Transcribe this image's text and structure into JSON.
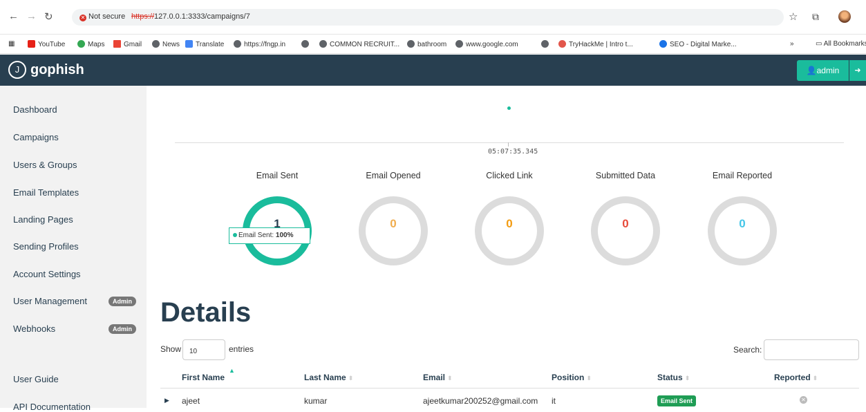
{
  "browser": {
    "not_secure": "Not secure",
    "url_scheme": "https://",
    "url_rest": "127.0.0.1:3333/campaigns/7",
    "bookmarks": [
      "YouTube",
      "Maps",
      "Gmail",
      "News",
      "Translate",
      "https://fngp.in",
      "",
      "COMMON RECRUIT...",
      "bathroom",
      "www.google.com",
      "",
      "TryHackMe | Intro t...",
      "SEO - Digital Marke..."
    ],
    "bookmarks_more": "»",
    "all_bookmarks": "All Bookmarks"
  },
  "navbar": {
    "logo": "J",
    "brand": "gophish",
    "user": "admin"
  },
  "sidebar": {
    "items": [
      "Dashboard",
      "Campaigns",
      "Users & Groups",
      "Email Templates",
      "Landing Pages",
      "Sending Profiles",
      "Account Settings",
      "User Management",
      "Webhooks"
    ],
    "admin_badge": "Admin",
    "guide": "User Guide",
    "api": "API Documentation"
  },
  "timeline": {
    "label": "05:07:35.345"
  },
  "metrics": [
    {
      "title": "Email Sent",
      "value": "1",
      "color": "#1abc9c",
      "fraction": 1.0
    },
    {
      "title": "Email Opened",
      "value": "0",
      "color": "#f0ad4e",
      "fraction": 0
    },
    {
      "title": "Clicked Link",
      "value": "0",
      "color": "#f39c12",
      "fraction": 0
    },
    {
      "title": "Submitted Data",
      "value": "0",
      "color": "#e74c3c",
      "fraction": 0
    },
    {
      "title": "Email Reported",
      "value": "0",
      "color": "#45c6e8",
      "fraction": 0
    }
  ],
  "tooltip": {
    "label": "Email Sent:",
    "value": "100%"
  },
  "details": {
    "title": "Details",
    "show": "Show",
    "length": "10",
    "entries": "entries",
    "search": "Search:",
    "columns": [
      "First Name",
      "Last Name",
      "Email",
      "Position",
      "Status",
      "Reported"
    ],
    "rows": [
      {
        "first": "ajeet",
        "last": "kumar",
        "email": "ajeetkumar200252@gmail.com",
        "position": "it",
        "status": "Email Sent"
      }
    ]
  }
}
